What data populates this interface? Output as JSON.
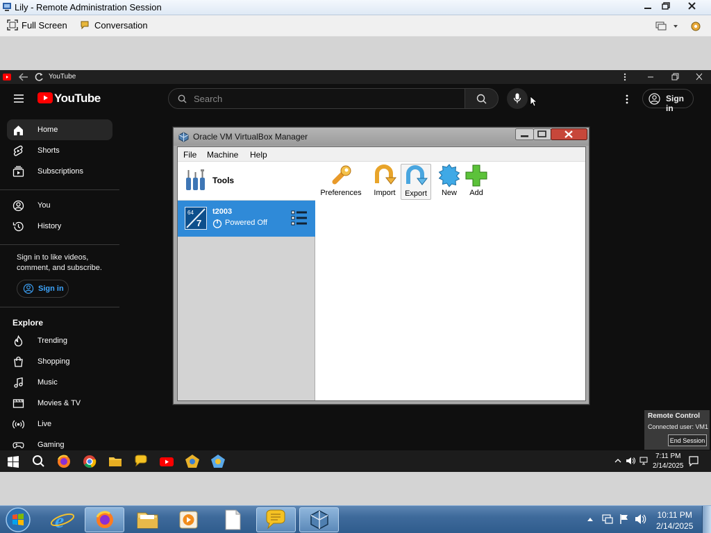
{
  "outer_window": {
    "title": "Lily - Remote Administration Session",
    "toolbar": {
      "full_screen": "Full Screen",
      "conversation": "Conversation"
    }
  },
  "browser": {
    "tab_title": "YouTube",
    "youtube": {
      "logo_text": "YouTube",
      "search_placeholder": "Search",
      "sign_in": "Sign in",
      "nav": [
        {
          "label": "Home",
          "icon": "home-icon"
        },
        {
          "label": "Shorts",
          "icon": "shorts-icon"
        },
        {
          "label": "Subscriptions",
          "icon": "subscriptions-icon"
        },
        {
          "label": "You",
          "icon": "you-icon"
        },
        {
          "label": "History",
          "icon": "history-icon"
        }
      ],
      "prompt": "Sign in to like videos, comment, and subscribe.",
      "sign_in_side": "Sign in",
      "explore_heading": "Explore",
      "explore": [
        {
          "label": "Trending",
          "icon": "trending-icon"
        },
        {
          "label": "Shopping",
          "icon": "shopping-icon"
        },
        {
          "label": "Music",
          "icon": "music-icon"
        },
        {
          "label": "Movies & TV",
          "icon": "movies-icon"
        },
        {
          "label": "Live",
          "icon": "live-icon"
        },
        {
          "label": "Gaming",
          "icon": "gaming-icon"
        }
      ]
    }
  },
  "virtualbox": {
    "title": "Oracle VM VirtualBox Manager",
    "menu": [
      "File",
      "Machine",
      "Help"
    ],
    "tools_label": "Tools",
    "vm": {
      "name": "t2003",
      "state": "Powered Off"
    },
    "toolbar": [
      {
        "label": "Preferences",
        "icon": "preferences-icon"
      },
      {
        "label": "Import",
        "icon": "import-icon"
      },
      {
        "label": "Export",
        "icon": "export-icon"
      },
      {
        "label": "New",
        "icon": "new-icon"
      },
      {
        "label": "Add",
        "icon": "add-icon"
      }
    ]
  },
  "remote_control": {
    "heading": "Remote Control",
    "status": "Connected user: VM1",
    "end_session": "End Session"
  },
  "remote_taskbar": {
    "time": "7:11 PM",
    "date": "2/14/2025"
  },
  "host_taskbar": {
    "time": "10:11 PM",
    "date": "2/14/2025"
  },
  "colors": {
    "youtube_red": "#ff0000",
    "vm_selected": "#2f8ad8",
    "link_blue": "#3ea6ff"
  }
}
